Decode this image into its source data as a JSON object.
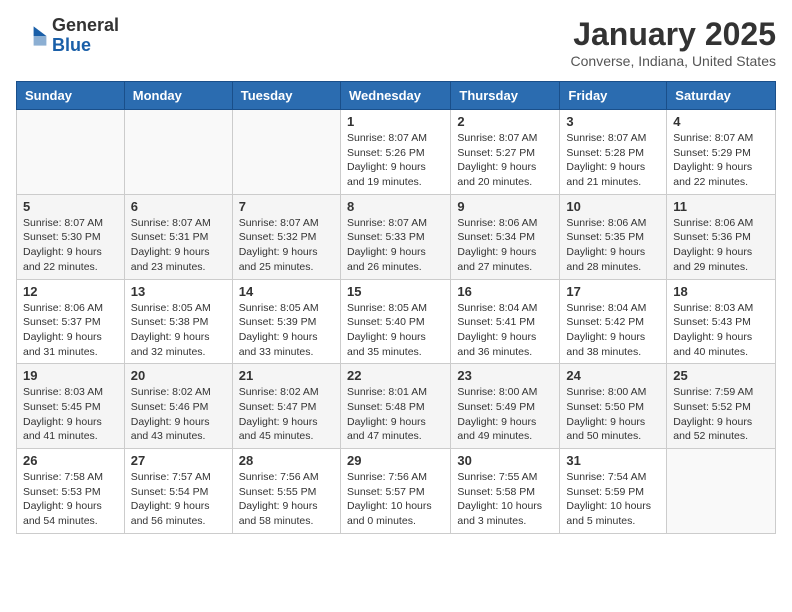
{
  "header": {
    "logo_general": "General",
    "logo_blue": "Blue",
    "month": "January 2025",
    "location": "Converse, Indiana, United States"
  },
  "weekdays": [
    "Sunday",
    "Monday",
    "Tuesday",
    "Wednesday",
    "Thursday",
    "Friday",
    "Saturday"
  ],
  "weeks": [
    [
      {
        "day": "",
        "sunrise": "",
        "sunset": "",
        "daylight": ""
      },
      {
        "day": "",
        "sunrise": "",
        "sunset": "",
        "daylight": ""
      },
      {
        "day": "",
        "sunrise": "",
        "sunset": "",
        "daylight": ""
      },
      {
        "day": "1",
        "sunrise": "8:07 AM",
        "sunset": "5:26 PM",
        "daylight": "9 hours and 19 minutes."
      },
      {
        "day": "2",
        "sunrise": "8:07 AM",
        "sunset": "5:27 PM",
        "daylight": "9 hours and 20 minutes."
      },
      {
        "day": "3",
        "sunrise": "8:07 AM",
        "sunset": "5:28 PM",
        "daylight": "9 hours and 21 minutes."
      },
      {
        "day": "4",
        "sunrise": "8:07 AM",
        "sunset": "5:29 PM",
        "daylight": "9 hours and 22 minutes."
      }
    ],
    [
      {
        "day": "5",
        "sunrise": "8:07 AM",
        "sunset": "5:30 PM",
        "daylight": "9 hours and 22 minutes."
      },
      {
        "day": "6",
        "sunrise": "8:07 AM",
        "sunset": "5:31 PM",
        "daylight": "9 hours and 23 minutes."
      },
      {
        "day": "7",
        "sunrise": "8:07 AM",
        "sunset": "5:32 PM",
        "daylight": "9 hours and 25 minutes."
      },
      {
        "day": "8",
        "sunrise": "8:07 AM",
        "sunset": "5:33 PM",
        "daylight": "9 hours and 26 minutes."
      },
      {
        "day": "9",
        "sunrise": "8:06 AM",
        "sunset": "5:34 PM",
        "daylight": "9 hours and 27 minutes."
      },
      {
        "day": "10",
        "sunrise": "8:06 AM",
        "sunset": "5:35 PM",
        "daylight": "9 hours and 28 minutes."
      },
      {
        "day": "11",
        "sunrise": "8:06 AM",
        "sunset": "5:36 PM",
        "daylight": "9 hours and 29 minutes."
      }
    ],
    [
      {
        "day": "12",
        "sunrise": "8:06 AM",
        "sunset": "5:37 PM",
        "daylight": "9 hours and 31 minutes."
      },
      {
        "day": "13",
        "sunrise": "8:05 AM",
        "sunset": "5:38 PM",
        "daylight": "9 hours and 32 minutes."
      },
      {
        "day": "14",
        "sunrise": "8:05 AM",
        "sunset": "5:39 PM",
        "daylight": "9 hours and 33 minutes."
      },
      {
        "day": "15",
        "sunrise": "8:05 AM",
        "sunset": "5:40 PM",
        "daylight": "9 hours and 35 minutes."
      },
      {
        "day": "16",
        "sunrise": "8:04 AM",
        "sunset": "5:41 PM",
        "daylight": "9 hours and 36 minutes."
      },
      {
        "day": "17",
        "sunrise": "8:04 AM",
        "sunset": "5:42 PM",
        "daylight": "9 hours and 38 minutes."
      },
      {
        "day": "18",
        "sunrise": "8:03 AM",
        "sunset": "5:43 PM",
        "daylight": "9 hours and 40 minutes."
      }
    ],
    [
      {
        "day": "19",
        "sunrise": "8:03 AM",
        "sunset": "5:45 PM",
        "daylight": "9 hours and 41 minutes."
      },
      {
        "day": "20",
        "sunrise": "8:02 AM",
        "sunset": "5:46 PM",
        "daylight": "9 hours and 43 minutes."
      },
      {
        "day": "21",
        "sunrise": "8:02 AM",
        "sunset": "5:47 PM",
        "daylight": "9 hours and 45 minutes."
      },
      {
        "day": "22",
        "sunrise": "8:01 AM",
        "sunset": "5:48 PM",
        "daylight": "9 hours and 47 minutes."
      },
      {
        "day": "23",
        "sunrise": "8:00 AM",
        "sunset": "5:49 PM",
        "daylight": "9 hours and 49 minutes."
      },
      {
        "day": "24",
        "sunrise": "8:00 AM",
        "sunset": "5:50 PM",
        "daylight": "9 hours and 50 minutes."
      },
      {
        "day": "25",
        "sunrise": "7:59 AM",
        "sunset": "5:52 PM",
        "daylight": "9 hours and 52 minutes."
      }
    ],
    [
      {
        "day": "26",
        "sunrise": "7:58 AM",
        "sunset": "5:53 PM",
        "daylight": "9 hours and 54 minutes."
      },
      {
        "day": "27",
        "sunrise": "7:57 AM",
        "sunset": "5:54 PM",
        "daylight": "9 hours and 56 minutes."
      },
      {
        "day": "28",
        "sunrise": "7:56 AM",
        "sunset": "5:55 PM",
        "daylight": "9 hours and 58 minutes."
      },
      {
        "day": "29",
        "sunrise": "7:56 AM",
        "sunset": "5:57 PM",
        "daylight": "10 hours and 0 minutes."
      },
      {
        "day": "30",
        "sunrise": "7:55 AM",
        "sunset": "5:58 PM",
        "daylight": "10 hours and 3 minutes."
      },
      {
        "day": "31",
        "sunrise": "7:54 AM",
        "sunset": "5:59 PM",
        "daylight": "10 hours and 5 minutes."
      },
      {
        "day": "",
        "sunrise": "",
        "sunset": "",
        "daylight": ""
      }
    ]
  ]
}
